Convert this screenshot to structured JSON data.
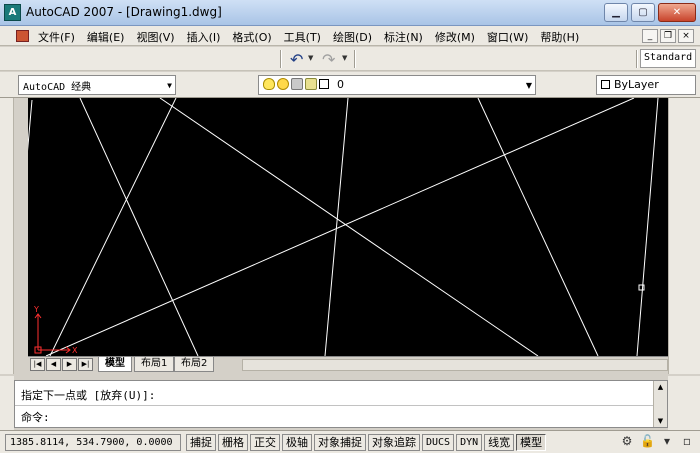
{
  "window": {
    "title": "AutoCAD 2007 - [Drawing1.dwg]",
    "app_icon_label": "A",
    "minimize_glyph": "▁",
    "maximize_glyph": "▢",
    "close_glyph": "✕"
  },
  "menu": {
    "items": [
      "文件(F)",
      "编辑(E)",
      "视图(V)",
      "插入(I)",
      "格式(O)",
      "工具(T)",
      "绘图(D)",
      "标注(N)",
      "修改(M)",
      "窗口(W)",
      "帮助(H)"
    ],
    "mdi_minimize": "_",
    "mdi_restore": "❐",
    "mdi_close": "×"
  },
  "toolbar": {
    "undo_glyph": "↶",
    "redo_glyph": "↷",
    "text_style": "Standard"
  },
  "workspace": {
    "value": "AutoCAD 经典",
    "arrow": "▼"
  },
  "layer": {
    "name": "0",
    "arrow": "▼"
  },
  "color": {
    "value": "ByLayer"
  },
  "ucs": {
    "x_label": "X",
    "y_label": "Y"
  },
  "layout_tabs": {
    "nav": [
      "|◀",
      "◀",
      "▶",
      "▶|"
    ],
    "tabs": [
      "模型",
      "布局1",
      "布局2"
    ],
    "active": "模型"
  },
  "command": {
    "history_line": "指定下一点或 [放弃(U)]:",
    "prompt": "命令:",
    "scroll_up": "▲",
    "scroll_down": "▼"
  },
  "status": {
    "coordinates": "1385.8114, 534.7900, 0.0000",
    "buttons": [
      "捕捉",
      "栅格",
      "正交",
      "极轴",
      "对象捕捉",
      "对象追踪",
      "DUCS",
      "DYN",
      "线宽",
      "模型"
    ],
    "tray_glyphs": [
      "⚙",
      "🔓",
      "▾",
      "▫"
    ]
  },
  "colors": {
    "canvas_bg": "#000000",
    "line_color": "#ffffff",
    "ucs_color": "#ff3030",
    "title_gradient_top": "#cfe0f5"
  }
}
